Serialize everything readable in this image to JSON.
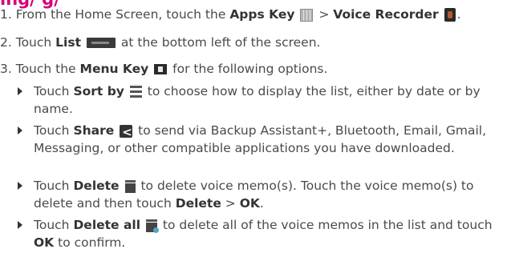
{
  "heading": "ing/ g/",
  "steps": [
    {
      "num": "1.",
      "pre": "From the Home Screen, touch the",
      "key1": "Apps Key",
      "sep": ">",
      "key2": "Voice Recorder",
      "end": "."
    },
    {
      "num": "2.",
      "pre": "Touch",
      "key": "List",
      "post": "at the bottom left of the screen."
    },
    {
      "num": "3.",
      "pre": "Touch the",
      "key": "Menu Key",
      "post": "for the following options."
    }
  ],
  "options": [
    {
      "pre": "Touch",
      "key": "Sort by",
      "text": "to choose how to display the list, either by date or by name."
    },
    {
      "pre": "Touch",
      "key": "Share",
      "text": "to send via Backup Assistant+, Bluetooth, Email, Gmail, Messaging, or other compatible applications you have downloaded."
    },
    {
      "pre": "Touch",
      "key": "Delete",
      "text": "to delete voice memo(s). Touch the voice memo(s) to delete and then touch",
      "key2": "Delete",
      "sep": ">",
      "key3": "OK",
      "end": "."
    },
    {
      "pre": "Touch",
      "key": "Delete all",
      "text": "to delete all of the voice memos in the list and touch",
      "key2": "OK",
      "end": "to confirm."
    }
  ]
}
